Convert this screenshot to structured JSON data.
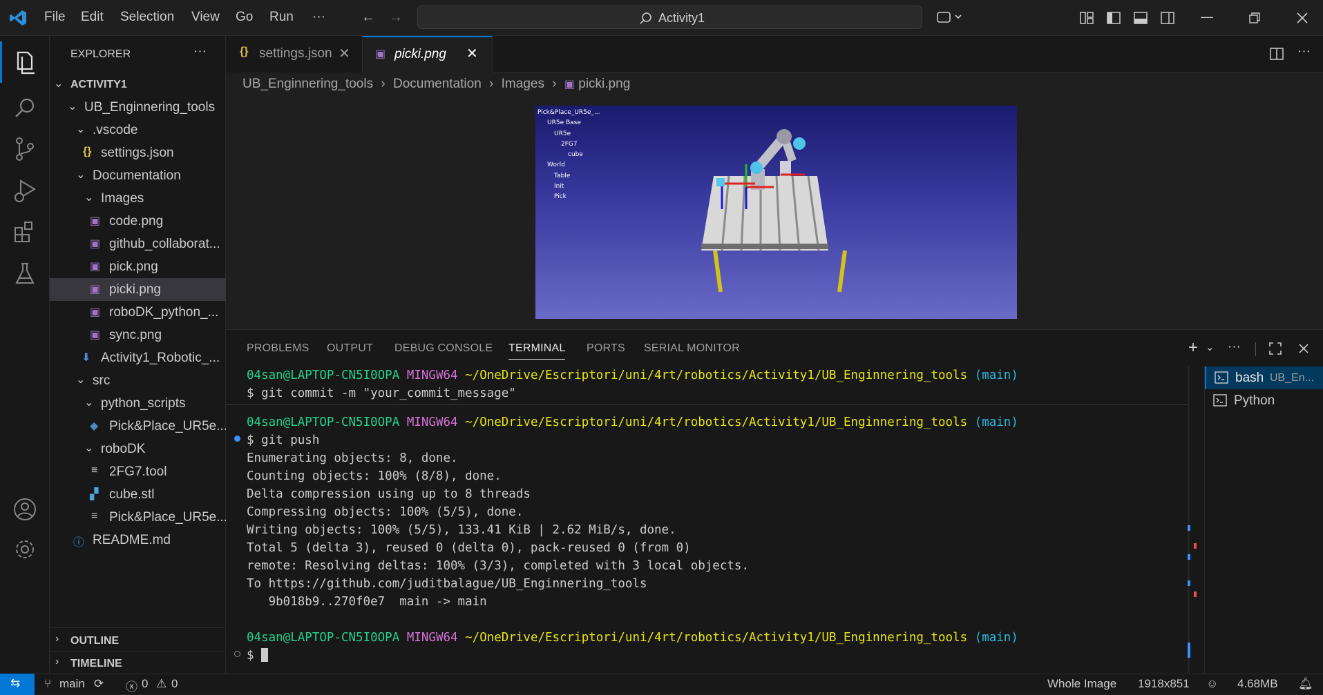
{
  "menu": [
    "File",
    "Edit",
    "Selection",
    "View",
    "Go",
    "Run",
    "···"
  ],
  "search": {
    "label": "Activity1"
  },
  "explorer": {
    "title": "EXPLORER",
    "more": "···",
    "workspace": "ACTIVITY1",
    "items": [
      {
        "label": "UB_Enginnering_tools",
        "kind": "folder"
      },
      {
        "label": ".vscode",
        "kind": "folder"
      },
      {
        "label": "settings.json",
        "kind": "json"
      },
      {
        "label": "Documentation",
        "kind": "folder"
      },
      {
        "label": "Images",
        "kind": "folder"
      },
      {
        "label": "code.png",
        "kind": "image"
      },
      {
        "label": "github_collaborat...",
        "kind": "image"
      },
      {
        "label": "pick.png",
        "kind": "image"
      },
      {
        "label": "picki.png",
        "kind": "image"
      },
      {
        "label": "roboDK_python_...",
        "kind": "image"
      },
      {
        "label": "sync.png",
        "kind": "image"
      },
      {
        "label": "Activity1_Robotic_...",
        "kind": "download"
      },
      {
        "label": "src",
        "kind": "folder"
      },
      {
        "label": "python_scripts",
        "kind": "folder"
      },
      {
        "label": "Pick&Place_UR5e...",
        "kind": "python"
      },
      {
        "label": "roboDK",
        "kind": "folder"
      },
      {
        "label": "2FG7.tool",
        "kind": "text"
      },
      {
        "label": "cube.stl",
        "kind": "stl"
      },
      {
        "label": "Pick&Place_UR5e...",
        "kind": "text"
      },
      {
        "label": "README.md",
        "kind": "info"
      }
    ],
    "outline": "OUTLINE",
    "timeline": "TIMELINE"
  },
  "tabs": [
    {
      "label": "settings.json",
      "icon": "{}"
    },
    {
      "label": "picki.png",
      "icon": "image"
    }
  ],
  "breadcrumb": [
    "UB_Enginnering_tools",
    "Documentation",
    "Images",
    "picki.png"
  ],
  "image_tree": [
    "Pick&Place_UR5e_...",
    "UR5e Base",
    "UR5e",
    "2FG7",
    "cube",
    "World",
    "Table",
    "Init",
    "Pick"
  ],
  "panel_tabs": [
    "PROBLEMS",
    "OUTPUT",
    "DEBUG CONSOLE",
    "TERMINAL",
    "PORTS",
    "SERIAL MONITOR"
  ],
  "terminal": {
    "user": "04san@LAPTOP-CN5I0OPA",
    "mingw": "MINGW64",
    "path": "~/OneDrive/Escriptori/uni/4rt/robotics/Activity1/UB_Enginnering_tools",
    "branch": "(main)",
    "cmd1": "$ git commit -m \"your_commit_message\"",
    "cmd2": "$ git push",
    "output": [
      "Enumerating objects: 8, done.",
      "Counting objects: 100% (8/8), done.",
      "Delta compression using up to 8 threads",
      "Compressing objects: 100% (5/5), done.",
      "Writing objects: 100% (5/5), 133.41 KiB | 2.62 MiB/s, done.",
      "Total 5 (delta 3), reused 0 (delta 0), pack-reused 0 (from 0)",
      "remote: Resolving deltas: 100% (3/3), completed with 3 local objects.",
      "To https://github.com/juditbalague/UB_Enginnering_tools",
      "   9b018b9..270f0e7  main -> main"
    ],
    "prompt": "$"
  },
  "terminal_list": [
    {
      "label": "bash",
      "sub": "UB_En..."
    },
    {
      "label": "Python",
      "sub": ""
    }
  ],
  "statusbar": {
    "branch": "main",
    "errors": "0",
    "warnings": "0",
    "image_mode": "Whole Image",
    "dimensions": "1918x851",
    "size": "4.68MB"
  }
}
